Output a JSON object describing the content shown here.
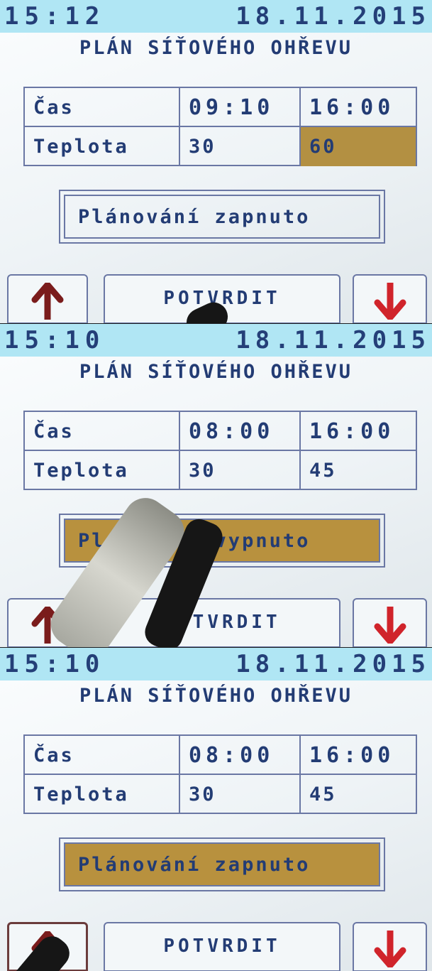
{
  "screens": [
    {
      "status": {
        "time": "15:12",
        "date": "18.11.2015"
      },
      "title": "PLÁN SÍŤOVÉHO OHŘEVU",
      "table": {
        "rows": [
          {
            "label": "Čas",
            "value1": "09:10",
            "value2": "16:00"
          },
          {
            "label": "Teplota",
            "value1": "30",
            "value2": "60"
          }
        ]
      },
      "planning_status": "Plánování zapnuto",
      "buttons": {
        "confirm": "POTVRDIT"
      }
    },
    {
      "status": {
        "time": "15:10",
        "date": "18.11.2015"
      },
      "title": "PLÁN SÍŤOVÉHO OHŘEVU",
      "table": {
        "rows": [
          {
            "label": "Čas",
            "value1": "08:00",
            "value2": "16:00"
          },
          {
            "label": "Teplota",
            "value1": "30",
            "value2": "45"
          }
        ]
      },
      "planning_status": "Plánování vypnuto",
      "buttons": {
        "confirm": "POTVRDIT"
      }
    },
    {
      "status": {
        "time": "15:10",
        "date": "18.11.2015"
      },
      "title": "PLÁN SÍŤOVÉHO OHŘEVU",
      "table": {
        "rows": [
          {
            "label": "Čas",
            "value1": "08:00",
            "value2": "16:00"
          },
          {
            "label": "Teplota",
            "value1": "30",
            "value2": "45"
          }
        ]
      },
      "planning_status": "Plánování zapnuto",
      "buttons": {
        "confirm": "POTVRDIT"
      }
    }
  ],
  "colors": {
    "status_bar": "#b0e6f4",
    "text": "#233c74",
    "highlight": "#b8913e",
    "arrow_up": "#7a1c1c",
    "arrow_down": "#d0242b"
  },
  "icons": {
    "up": "arrow-up-icon",
    "down": "arrow-down-icon"
  }
}
